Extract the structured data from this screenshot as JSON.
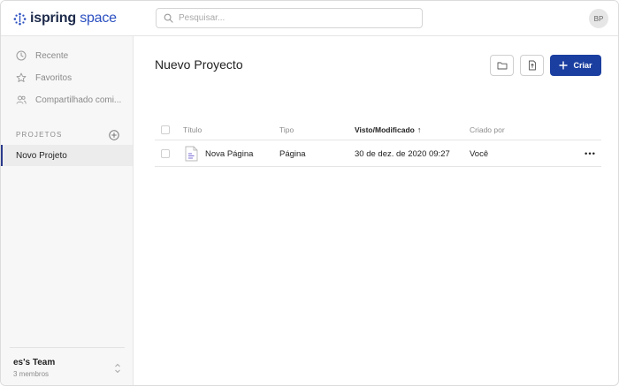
{
  "header": {
    "logo_main": "ispring",
    "logo_accent": "space",
    "search_placeholder": "Pesquisar...",
    "avatar_initials": "BP"
  },
  "sidebar": {
    "nav": [
      {
        "label": "Recente",
        "icon": "clock-icon"
      },
      {
        "label": "Favoritos",
        "icon": "star-icon"
      },
      {
        "label": "Compartilhado comi..."
      }
    ],
    "projects_label": "PROJETOS",
    "projects": [
      {
        "label": "Novo Projeto",
        "active": true
      }
    ],
    "team": {
      "name": "es's Team",
      "members": "3 membros"
    }
  },
  "main": {
    "title": "Nuevo Proyecto",
    "create_label": "Criar",
    "table": {
      "columns": [
        {
          "label": "Título"
        },
        {
          "label": "Tipo"
        },
        {
          "label": "Visto/Modificado",
          "sorted": true,
          "sort_glyph": "↑"
        },
        {
          "label": "Criado por"
        }
      ],
      "rows": [
        {
          "title": "Nova Página",
          "type": "Página",
          "modified": "30 de dez. de 2020 09:27",
          "created_by": "Você",
          "menu": "•••"
        }
      ]
    }
  },
  "colors": {
    "brand": "#2a4fc0",
    "primary_button": "#1b3fa0",
    "active_indicator": "#2a3a8c"
  }
}
